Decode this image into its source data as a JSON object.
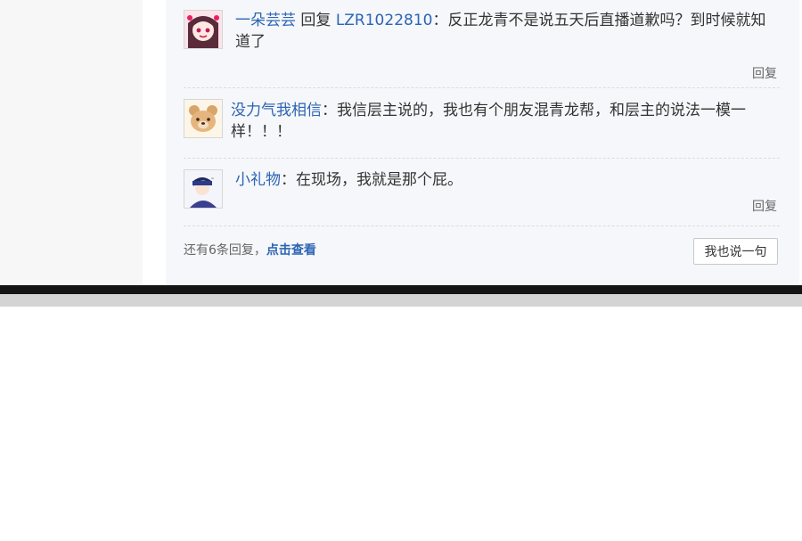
{
  "replies": [
    {
      "username": "一朵芸芸",
      "reply_word": "回复",
      "target": "LZR1022810",
      "colon": "：",
      "text": "反正龙青不是说五天后直播道歉吗？到时候就知道了",
      "reply_label": "回复",
      "avatar_icon": "anime-girl-avatar-icon"
    },
    {
      "username": "没力气我相信",
      "colon": "：",
      "text": "我信层主说的，我也有个朋友混青龙帮，和层主的说法一模一样！！！",
      "avatar_icon": "bear-avatar-icon"
    },
    {
      "username": "小礼物",
      "colon": "：",
      "text": "在现场，我就是那个屁。",
      "reply_label": "回复",
      "avatar_icon": "boy-avatar-icon"
    }
  ],
  "footer": {
    "more_prefix": "还有6条回复，",
    "more_link": "点击查看",
    "say_button": "我也说一句"
  },
  "colors": {
    "link": "#2d64b3",
    "text": "#333333",
    "panel_bg": "#f5f7fa",
    "bezel": "#141414"
  }
}
